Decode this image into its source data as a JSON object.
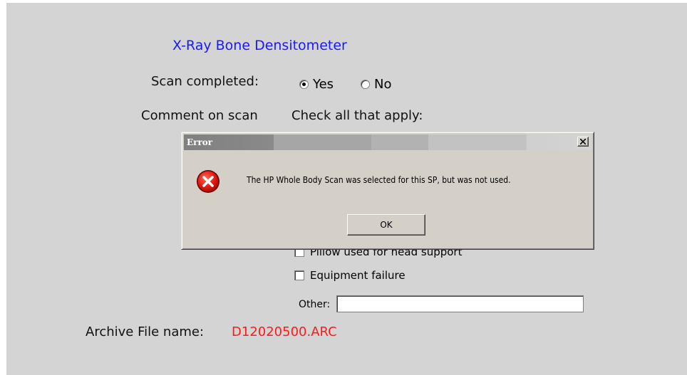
{
  "form": {
    "title": "X-Ray Bone Densitometer",
    "scan_completed_label": "Scan completed:",
    "scan_options": [
      {
        "label": "Yes",
        "selected": true
      },
      {
        "label": "No",
        "selected": false
      }
    ],
    "comment_label": "Comment on scan",
    "check_all_label": "Check all that apply:",
    "checkboxes": [
      {
        "label": "Pillow used for head support",
        "checked": false
      },
      {
        "label": "Equipment failure",
        "checked": false
      }
    ],
    "other_label": "Other:",
    "other_value": "",
    "archive_label": "Archive File name:",
    "archive_value": "D12020500.ARC"
  },
  "dialog": {
    "title": "Error",
    "close_label": "x",
    "icon": "error-icon",
    "message": "The HP Whole Body Scan was selected for this SP, but was not used.",
    "ok_label": "OK"
  },
  "colors": {
    "title": "#1a1aff",
    "archive_value": "#ff1a1a",
    "panel": "#d4d4d4",
    "dialog": "#d4d0c8"
  }
}
